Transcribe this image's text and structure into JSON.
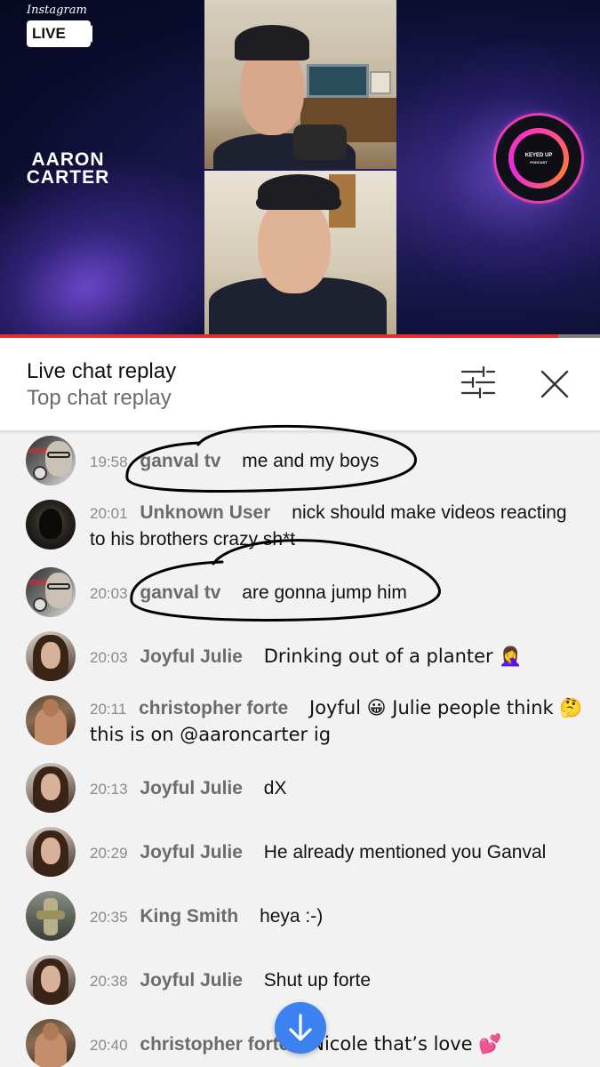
{
  "video": {
    "brand": "Instagram",
    "live_badge": "LIVE",
    "host_name_line1": "AARON",
    "host_name_line2": "CARTER",
    "podcast_logo_line1": "KEYED UP",
    "podcast_logo_line2": "PODCAST",
    "progress": 0.93,
    "progress_color": "#e12d2d"
  },
  "chat_header": {
    "title": "Live chat replay",
    "subtitle": "Top chat replay",
    "filter_icon": "filter-sliders-icon",
    "close_icon": "close-icon"
  },
  "messages": [
    {
      "time": "19:58",
      "author": "ganval tv",
      "text": "me and my boys",
      "avatar": "dxddy-avatar"
    },
    {
      "time": "20:01",
      "author": "Unknown User",
      "text": "nick should make videos reacting to his brothers crazy sh*t",
      "avatar": "hooded-figure-avatar"
    },
    {
      "time": "20:03",
      "author": "ganval tv",
      "text": "are gonna jump him",
      "avatar": "dxddy-avatar"
    },
    {
      "time": "20:03",
      "author": "Joyful Julie",
      "text": "Drinking out of a planter 🤦‍♀️",
      "avatar": "woman-portrait-avatar"
    },
    {
      "time": "20:11",
      "author": "christopher forte",
      "text": "Joyful 😀 Julie people think 🤔 this is on @aaroncarter ig",
      "avatar": "man-portrait-avatar"
    },
    {
      "time": "20:13",
      "author": "Joyful Julie",
      "text": "dX",
      "avatar": "woman-portrait-avatar"
    },
    {
      "time": "20:29",
      "author": "Joyful Julie",
      "text": "He already mentioned you Ganval",
      "avatar": "woman-portrait-avatar"
    },
    {
      "time": "20:35",
      "author": "King Smith",
      "text": "heya :-)",
      "avatar": "game-character-avatar"
    },
    {
      "time": "20:38",
      "author": "Joyful Julie",
      "text": "Shut up forte",
      "avatar": "woman-portrait-avatar"
    },
    {
      "time": "20:40",
      "author": "christopher forte",
      "text": "Nicole that’s love 💕",
      "avatar": "man-portrait-avatar"
    }
  ],
  "scroll_button": {
    "icon": "arrow-down-icon",
    "color": "#3b82f0"
  }
}
